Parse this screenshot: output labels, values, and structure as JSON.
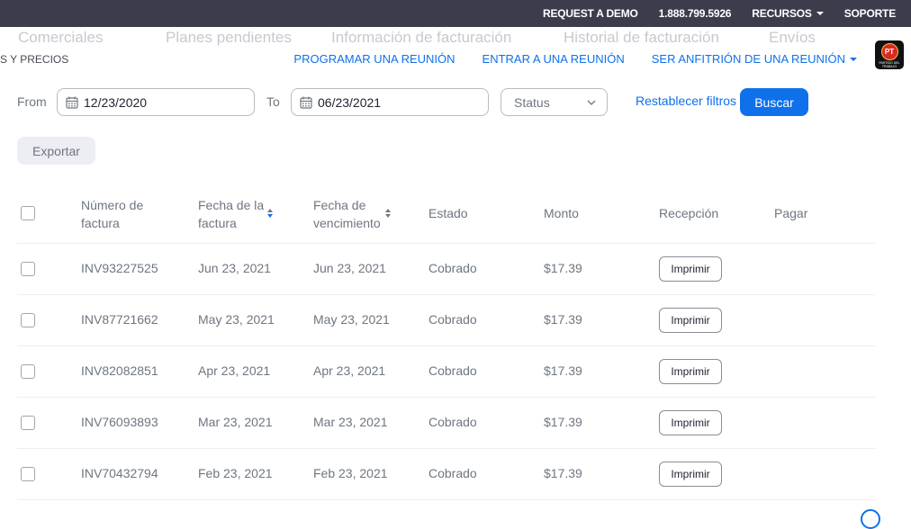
{
  "topbar": {
    "request_demo": "REQUEST A DEMO",
    "phone": "1.888.799.5926",
    "resources": "RECURSOS",
    "support": "SOPORTE"
  },
  "nav": {
    "ghost_tabs": [
      "Comerciales",
      "Planes pendientes",
      "Información de facturación",
      "Historial de facturación",
      "Envíos"
    ],
    "plans_label": "S Y PRECIOS",
    "schedule": "PROGRAMAR UNA REUNIÓN",
    "join": "ENTRAR A UNA REUNIÓN",
    "host": "SER ANFITRIÓN DE UNA REUNIÓN",
    "avatar_text": "PT",
    "avatar_sub": "PARTIDO DEL TRABAJO"
  },
  "filters": {
    "from_label": "From",
    "from_value": "12/23/2020",
    "to_label": "To",
    "to_value": "06/23/2021",
    "status_placeholder": "Status",
    "reset_label": "Restablecer filtros",
    "search_label": "Buscar",
    "export_label": "Exportar"
  },
  "table": {
    "headers": {
      "invoice_number": [
        "Número de",
        "factura"
      ],
      "invoice_date": [
        "Fecha de la",
        "factura"
      ],
      "due_date": [
        "Fecha de",
        "vencimiento"
      ],
      "status": "Estado",
      "amount": "Monto",
      "receipt": "Recepción",
      "pay": "Pagar"
    },
    "rows": [
      {
        "number": "INV93227525",
        "date": "Jun 23, 2021",
        "due": "Jun 23, 2021",
        "status": "Cobrado",
        "amount": "$17.39",
        "print": "Imprimir"
      },
      {
        "number": "INV87721662",
        "date": "May 23, 2021",
        "due": "May 23, 2021",
        "status": "Cobrado",
        "amount": "$17.39",
        "print": "Imprimir"
      },
      {
        "number": "INV82082851",
        "date": "Apr 23, 2021",
        "due": "Apr 23, 2021",
        "status": "Cobrado",
        "amount": "$17.39",
        "print": "Imprimir"
      },
      {
        "number": "INV76093893",
        "date": "Mar 23, 2021",
        "due": "Mar 23, 2021",
        "status": "Cobrado",
        "amount": "$17.39",
        "print": "Imprimir"
      },
      {
        "number": "INV70432794",
        "date": "Feb 23, 2021",
        "due": "Feb 23, 2021",
        "status": "Cobrado",
        "amount": "$17.39",
        "print": "Imprimir"
      }
    ]
  },
  "colors": {
    "topbar_bg": "#3b3d4c",
    "accent": "#0e71eb",
    "muted_text": "#6e7680"
  }
}
